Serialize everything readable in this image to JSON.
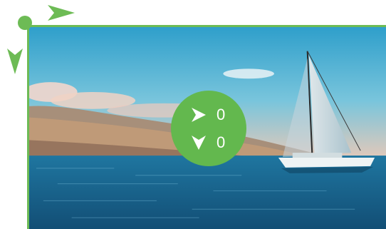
{
  "readout": {
    "x_value": "0",
    "y_value": "0",
    "x_icon": "arrow-right-icon",
    "y_icon": "arrow-down-icon"
  },
  "colors": {
    "accent": "#6dbb55",
    "readout_bg": "#63b84e",
    "text": "#ffffff"
  },
  "image": {
    "subject": "sailboat-on-sea",
    "sky": "#3aa7d0",
    "sea": "#1e6f9a"
  }
}
